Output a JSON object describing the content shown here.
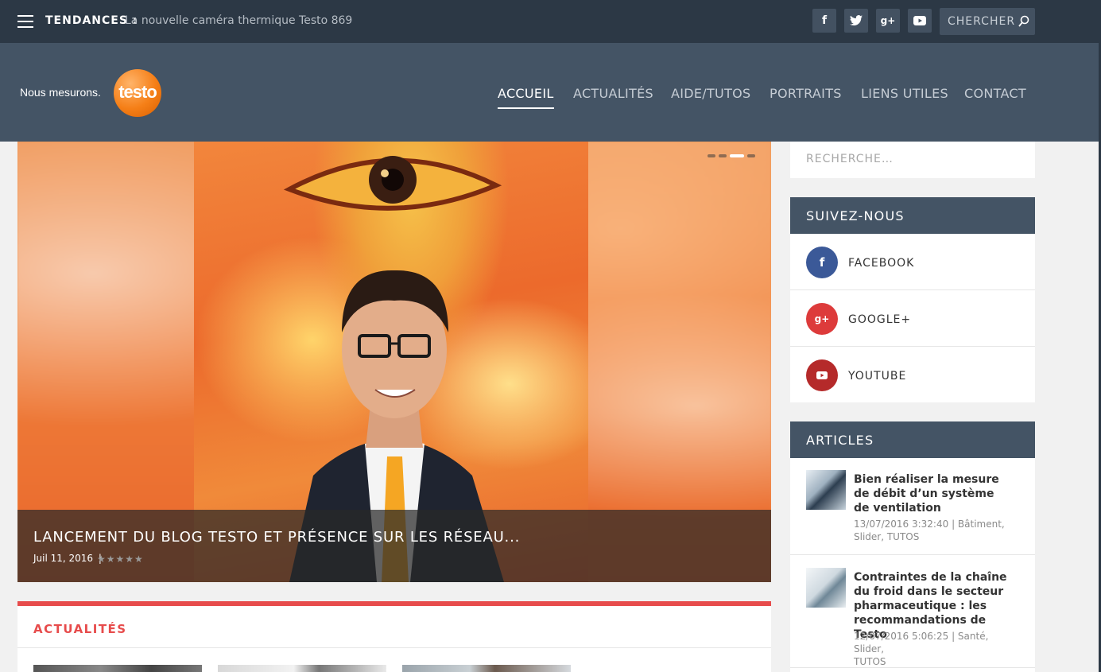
{
  "topbar": {
    "trend_label": "TENDANCES :",
    "trend_text": "La nouvelle caméra thermique Testo 869",
    "social_icons": [
      {
        "icon": "facebook-icon",
        "glyph": "f"
      },
      {
        "icon": "twitter-icon",
        "glyph": "t"
      },
      {
        "icon": "google-plus-icon",
        "glyph": "g+"
      },
      {
        "icon": "youtube-icon",
        "glyph": "▶"
      }
    ],
    "search_placeholder": "CHERCHER"
  },
  "header": {
    "logo_tagline": "Nous mesurons.",
    "logo_brand": "testo",
    "nav": [
      {
        "label": "ACCUEIL",
        "active": true
      },
      {
        "label": "ACTUALITÉS",
        "active": false
      },
      {
        "label": "AIDE/TUTOS",
        "active": false
      },
      {
        "label": "PORTRAITS",
        "active": false
      },
      {
        "label": "LIENS UTILES",
        "active": false
      },
      {
        "label": "CONTACT",
        "active": false
      }
    ]
  },
  "slider": {
    "title": "LANCEMENT DU BLOG TESTO ET PRÉSENCE SUR LES RÉSEAU...",
    "date": "Juil 11, 2016",
    "separator": "|",
    "rating_stars": "★★★★★",
    "slide_count": 4,
    "active_slide": 3
  },
  "news": {
    "title": "ACTUALITÉS"
  },
  "sidebar": {
    "search_placeholder": "RECHERCHE…",
    "follow": {
      "title": "SUIVEZ-NOUS",
      "items": [
        {
          "label": "FACEBOOK",
          "glyph": "f",
          "color": "#3b5998"
        },
        {
          "label": "GOOGLE+",
          "glyph": "g+",
          "color": "#dd3b3b"
        },
        {
          "label": "YOUTUBE",
          "glyph": "▶",
          "color": "#b52a2a"
        }
      ]
    },
    "articles": {
      "title": "ARTICLES",
      "items": [
        {
          "title": "Bien réaliser la mesure de débit d’un système de ventilation",
          "date": "13/07/2016 3:32:40",
          "categories_line1": "Bâtiment,",
          "categories_line2": "Slider, TUTOS"
        },
        {
          "title": "Contraintes de la chaîne du froid dans le secteur pharmaceutique : les recommandations de Testo",
          "date": "12/07/2016 5:06:25",
          "categories_line1": "Santé, Slider,",
          "categories_line2": "TUTOS"
        }
      ]
    }
  },
  "colors": {
    "topbar": "#2c3845",
    "header": "#445465",
    "accent_red": "#e74c4c",
    "brand_orange": "#f57f17"
  }
}
